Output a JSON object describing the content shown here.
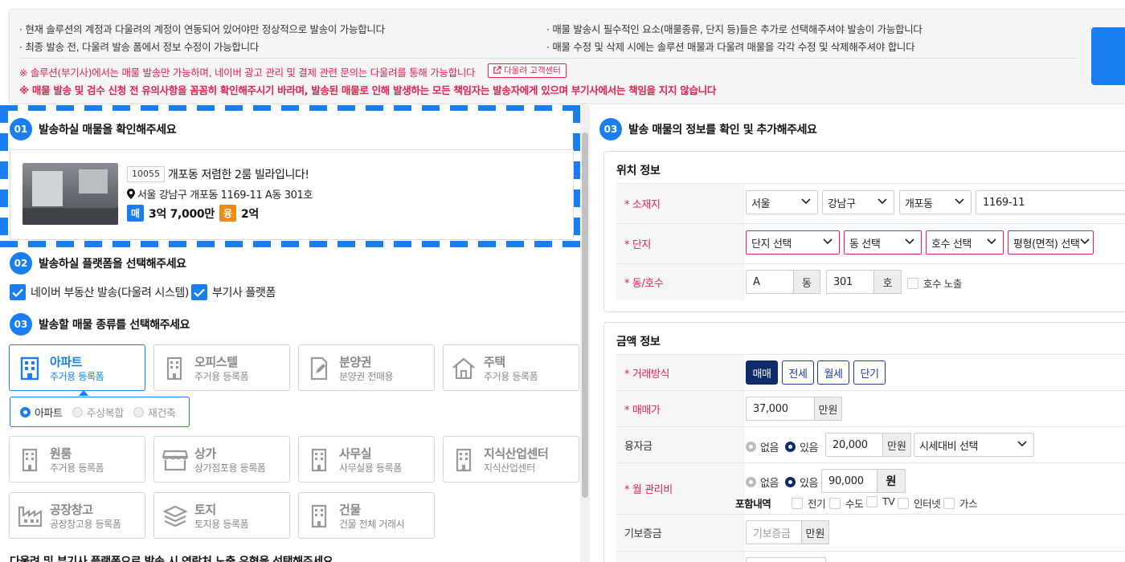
{
  "notice": {
    "lines_left": [
      "· 현재 솔루션의 계정과 다울려의 계정이 연동되어 있어야만 정상적으로 발송이 가능합니다",
      "· 최종 발송 전, 다울려 발송 폼에서 정보 수정이 가능합니다"
    ],
    "lines_right": [
      "· 매물 발송시 필수적인 요소(매물종류, 단지 등)들은 추가로 선택해주셔야 발송이 가능합니다",
      "· 매물 수정 및 삭제 시에는 솔루션 매물과 다울려 매물을 각각 수정 및 삭제해주셔야 합니다"
    ],
    "warn1": "※ 솔루션(부기사)에서는 매물 발송만 가능하며, 네이버 광고 관리 및 결제 관련 문의는 다울려를 통해 가능합니다",
    "cs_button": "다울려 고객센터",
    "warn2": "※ 매물 발송 및 검수 신청 전 유의사항을 꼼꼼히 확인해주시기 바라며, 발송된 매물로 인해 발생하는 모든 책임자는 발송자에게 있으며 부기사에서는 책임을 지지 않습니다"
  },
  "step1": {
    "num": "01",
    "title": "발송하실 매물을 확인해주세요"
  },
  "listing": {
    "id": "10055",
    "title": "개포동 저렴한 2룸 빌라입니다!",
    "address": "서울 강남구 개포동 1169-11 A동 301호",
    "sale_tag": "매",
    "sale_price": "3억 7,000만",
    "loan_tag": "융",
    "loan_price": "2억"
  },
  "step2": {
    "num": "02",
    "title": "발송하실 플랫폼을 선택해주세요"
  },
  "platforms": [
    "네이버 부동산 발송(다울려 시스템)",
    "부기사 플랫폼"
  ],
  "step3_left": {
    "num": "03",
    "title": "발송할 매물 종류를 선택해주세요"
  },
  "property_types": [
    {
      "name": "아파트",
      "sub": "주거용 등록폼",
      "icon": "building-icon",
      "active": true
    },
    {
      "name": "오피스텔",
      "sub": "주거용 등록폼",
      "icon": "building-icon"
    },
    {
      "name": "분양권",
      "sub": "분양권 전매용",
      "icon": "document-edit-icon"
    },
    {
      "name": "주택",
      "sub": "주거용 등록폼",
      "icon": "house-icon"
    },
    {
      "name": "원룸",
      "sub": "주거용 등록폼",
      "icon": "building-icon"
    },
    {
      "name": "상가",
      "sub": "상가점포용 등록폼",
      "icon": "store-icon"
    },
    {
      "name": "사무실",
      "sub": "사무실용 등록폼",
      "icon": "building-icon"
    },
    {
      "name": "지식산업센터",
      "sub": "지식산업센터",
      "icon": "building-icon"
    },
    {
      "name": "공장창고",
      "sub": "공장창고용 등록폼",
      "icon": "factory-icon"
    },
    {
      "name": "토지",
      "sub": "토지용 등록폼",
      "icon": "layers-icon"
    },
    {
      "name": "건물",
      "sub": "건물 전체 거래시",
      "icon": "building-icon"
    }
  ],
  "apt_subtypes": [
    {
      "label": "아파트",
      "selected": true
    },
    {
      "label": "주상복합",
      "selected": false
    },
    {
      "label": "재건축",
      "selected": false
    }
  ],
  "step4_cutoff": "다울려 및 부기사 플랫폼으로 발송 시 연락처 노출 유형을 선택해주세요",
  "step3_right": {
    "num": "03",
    "title": "발송 매물의 정보를 확인 및 추가해주세요"
  },
  "location": {
    "title": "위치 정보",
    "address_label": "* 소재지",
    "city": "서울",
    "district": "강남구",
    "dong": "개포동",
    "lot": "1169-11",
    "complex_label": "* 단지",
    "complex_select": "단지 선택",
    "building_select": "동 선택",
    "unit_select": "호수 선택",
    "area_select": "평형(면적) 선택",
    "dongho_label": "* 동/호수",
    "dong_value": "A",
    "dong_unit": "동",
    "ho_value": "301",
    "ho_unit": "호",
    "ho_expose": "호수 노출"
  },
  "price": {
    "title": "금액 정보",
    "deal_label": "* 거래방식",
    "deal_types": [
      "매매",
      "전세",
      "월세",
      "단기"
    ],
    "sale_label": "* 매매가",
    "sale_value": "37,000",
    "sale_unit": "만원",
    "loan_label": "융자금",
    "no": "없음",
    "yes": "있음",
    "loan_value": "20,000",
    "loan_unit": "만원",
    "loan_select": "시세대비 선택",
    "mgmt_label": "* 월 관리비",
    "mgmt_value": "90,000",
    "mgmt_unit": "원",
    "includes_label": "포함내역",
    "includes": [
      "전기",
      "수도",
      "TV",
      "인터넷",
      "가스"
    ],
    "deposit_label": "기보증금",
    "deposit_placeholder": "기보증금",
    "deposit_unit": "만원"
  },
  "colors": {
    "accent": "#1a7df0",
    "navy": "#0d2b6b",
    "warn": "#e0224e",
    "loan_orange": "#f08b16"
  }
}
